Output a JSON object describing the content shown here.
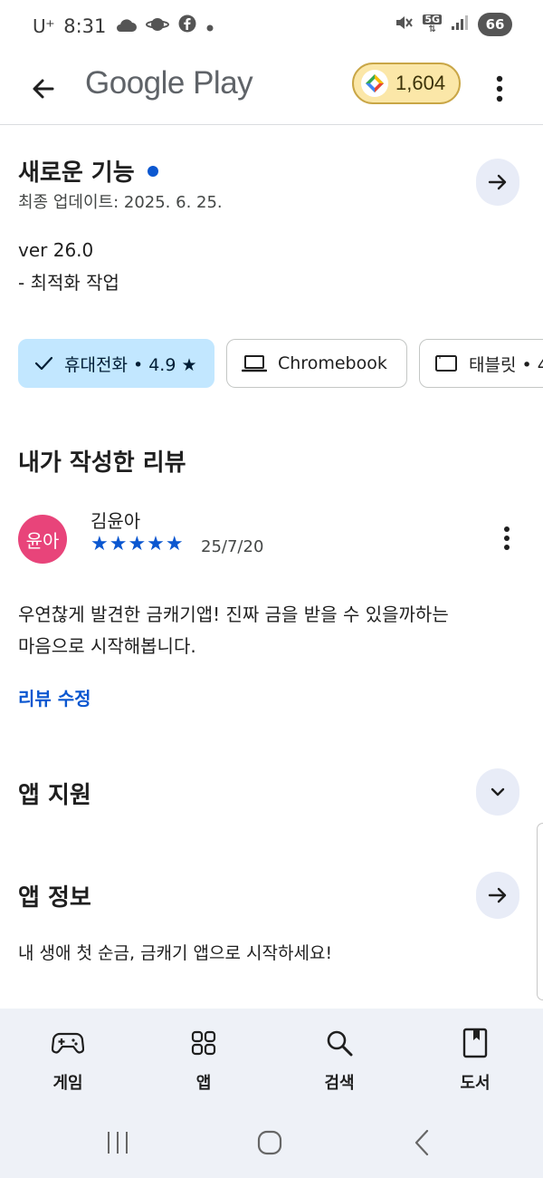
{
  "status_bar": {
    "carrier": "U⁺",
    "time": "8:31",
    "battery": "66",
    "network": "5G"
  },
  "app_bar": {
    "title": "Google Play",
    "points": "1,604"
  },
  "whats_new": {
    "title": "새로운 기능",
    "last_updated": "최종 업데이트: 2025. 6. 25.",
    "version": "ver 26.0",
    "note": "- 최적화 작업"
  },
  "device_chips": [
    {
      "label": "휴대전화 • 4.9 ★",
      "icon": "check-icon",
      "selected": true
    },
    {
      "label": "Chromebook",
      "icon": "laptop-icon",
      "selected": false
    },
    {
      "label": "태블릿 • 4",
      "icon": "tablet-icon",
      "selected": false
    }
  ],
  "my_review": {
    "title": "내가 작성한 리뷰",
    "avatar_text": "윤아",
    "reviewer": "김윤아",
    "stars": "★★★★★",
    "rating": 5,
    "date": "25/7/20",
    "text_line1": "우연찮게 발견한 금캐기앱! 진짜 금을 받을 수 있을까하는",
    "text_line2": "마음으로 시작해봅니다.",
    "edit_link": "리뷰 수정",
    "avatar_color": "#e8447a"
  },
  "app_support": {
    "title": "앱 지원"
  },
  "app_info": {
    "title": "앱 정보",
    "description": "내 생애 첫 순금, 금캐기 앱으로 시작하세요!"
  },
  "bottom_nav": [
    {
      "label": "게임",
      "icon": "gamepad-icon"
    },
    {
      "label": "앱",
      "icon": "apps-grid-icon"
    },
    {
      "label": "검색",
      "icon": "search-icon"
    },
    {
      "label": "도서",
      "icon": "book-icon"
    }
  ],
  "colors": {
    "accent": "#0b57d0",
    "chip_selected": "#c2e7ff",
    "points_pill": "#fbe7a8",
    "nav_background": "#eef1f7"
  }
}
